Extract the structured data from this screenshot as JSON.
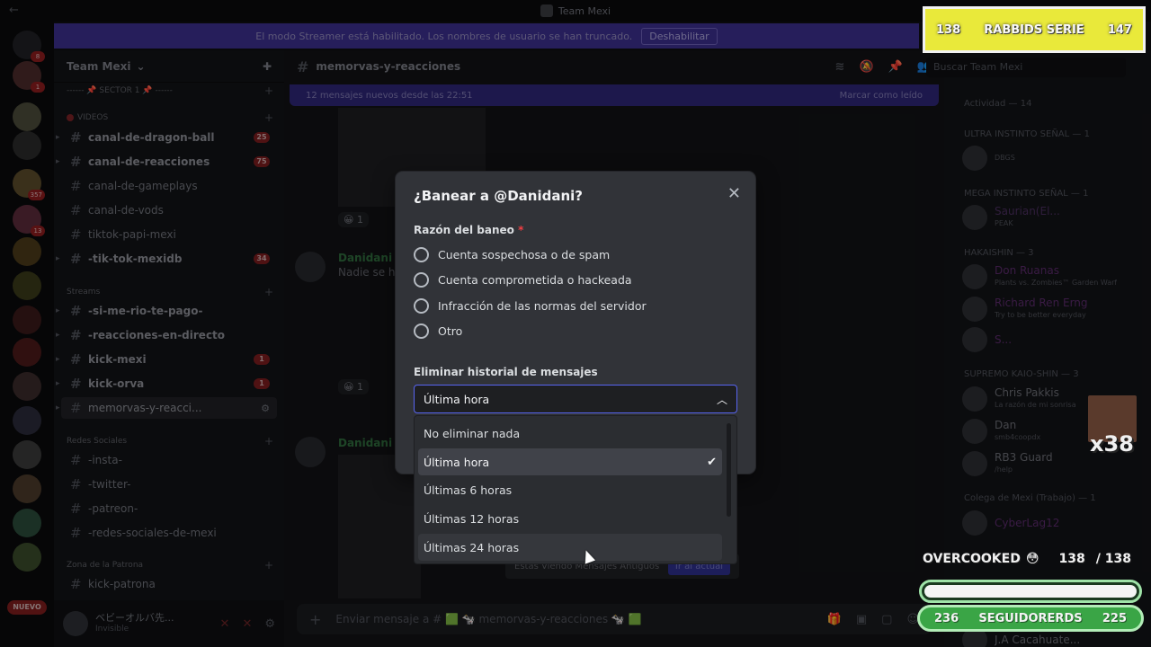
{
  "window": {
    "title": "Team Mexi"
  },
  "banner": {
    "text": "El modo Streamer está habilitado. Los nombres de usuario se han truncado.",
    "button": "Deshabilitar"
  },
  "rail": {
    "badges": [
      "8",
      "1",
      "357",
      "13"
    ],
    "new_label": "NUEVO"
  },
  "sidebar": {
    "server_name": "Team Mexi",
    "categories": {
      "sector": "------ 📌 SECTOR 1 📌 ------",
      "videos": "VIDEOS",
      "streams": "Streams",
      "redes": "Redes Sociales",
      "zona": "Zona de la Patrona"
    },
    "channels": [
      {
        "name": "canal-de-dragon-ball",
        "count": "25"
      },
      {
        "name": "canal-de-reacciones",
        "count": "75"
      },
      {
        "name": "canal-de-gameplays",
        "count": ""
      },
      {
        "name": "canal-de-vods",
        "count": ""
      },
      {
        "name": "tiktok-papi-mexi",
        "count": ""
      },
      {
        "name": "-tik-tok-mexidb",
        "count": "34"
      },
      {
        "name": "-si-me-rio-te-pago-",
        "count": ""
      },
      {
        "name": "-reacciones-en-directo",
        "count": ""
      },
      {
        "name": "kick-mexi",
        "count": "1"
      },
      {
        "name": "kick-orva",
        "count": "1"
      },
      {
        "name": "memorvas-y-reacci...",
        "count": ""
      },
      {
        "name": "-insta-",
        "count": ""
      },
      {
        "name": "-twitter-",
        "count": ""
      },
      {
        "name": "-patreon-",
        "count": ""
      },
      {
        "name": "-redes-sociales-de-mexi",
        "count": ""
      },
      {
        "name": "kick-patrona",
        "count": ""
      }
    ],
    "user": {
      "name": "ベビーオルバ先...",
      "status": "Invisible"
    }
  },
  "chat": {
    "channel": "memorvas-y-reacciones",
    "new_messages": "12 mensajes nuevos desde las 22:51",
    "mark_read": "Marcar como leído",
    "messages": [
      {
        "author": "Danidani",
        "text": "Nadie se ha"
      },
      {
        "author": "Danidani",
        "text": ""
      }
    ],
    "reaction_count": "1",
    "old_messages": "Estás Viendo Mensajes Antiguos",
    "go_current": "Ir al actual",
    "composer_placeholder": "Enviar mensaje a # 🟩 🐄 memorvas-y-reacciones 🐄 🟩"
  },
  "members": {
    "search_placeholder": "Buscar Team Mexi",
    "activity": "Actividad — 14",
    "groups": [
      {
        "label": "ULTRA INSTINTO SEÑAL — 1"
      },
      {
        "label": "MEGA INSTINTO SEÑAL — 1"
      },
      {
        "label": "HAKAISHIN — 3"
      },
      {
        "label": "SUPREMO KAIO-SHIN — 3"
      },
      {
        "label": "Colega de Mexi (Trabajo) — 1"
      }
    ],
    "people": [
      {
        "name": "",
        "sub": "DBGS"
      },
      {
        "name": "Saurian(El...",
        "sub": "PEAK"
      },
      {
        "name": "Don Ruanas",
        "sub": "Plants vs. Zombies™ Garden Warf"
      },
      {
        "name": "Richard Ren Erng",
        "sub": "Try to be better everyday"
      },
      {
        "name": "S...",
        "sub": ""
      },
      {
        "name": "Chris Pakkis",
        "sub": "La razón de mi sonrisa"
      },
      {
        "name": "Dan",
        "sub": "smb4coopdx"
      },
      {
        "name": "RB3 Guard",
        "sub": "/help"
      },
      {
        "name": "CyberLag12",
        "sub": ""
      },
      {
        "name": "J.A Cacahuate...",
        "sub": ""
      }
    ]
  },
  "overlay": {
    "top_left_num": "138",
    "top_title": "RABBIDS SERIE",
    "top_right_num": "147",
    "multiplier": "x38",
    "overcooked": "OVERCOOKED",
    "oc_current": "138",
    "oc_total": "/ 138",
    "followers_left": "236",
    "followers_label": "SEGUIDORERDS",
    "followers_right": "225"
  },
  "modal": {
    "title": "¿Banear a @Danidani?",
    "reason_label": "Razón del baneo",
    "required_mark": "*",
    "reasons": [
      "Cuenta sospechosa o de spam",
      "Cuenta comprometida o hackeada",
      "Infracción de las normas del servidor",
      "Otro"
    ],
    "history_label": "Eliminar historial de mensajes",
    "selected_value": "Última hora",
    "options": [
      "No eliminar nada",
      "Última hora",
      "Últimas 6 horas",
      "Últimas 12 horas",
      "Últimas 24 horas"
    ]
  }
}
